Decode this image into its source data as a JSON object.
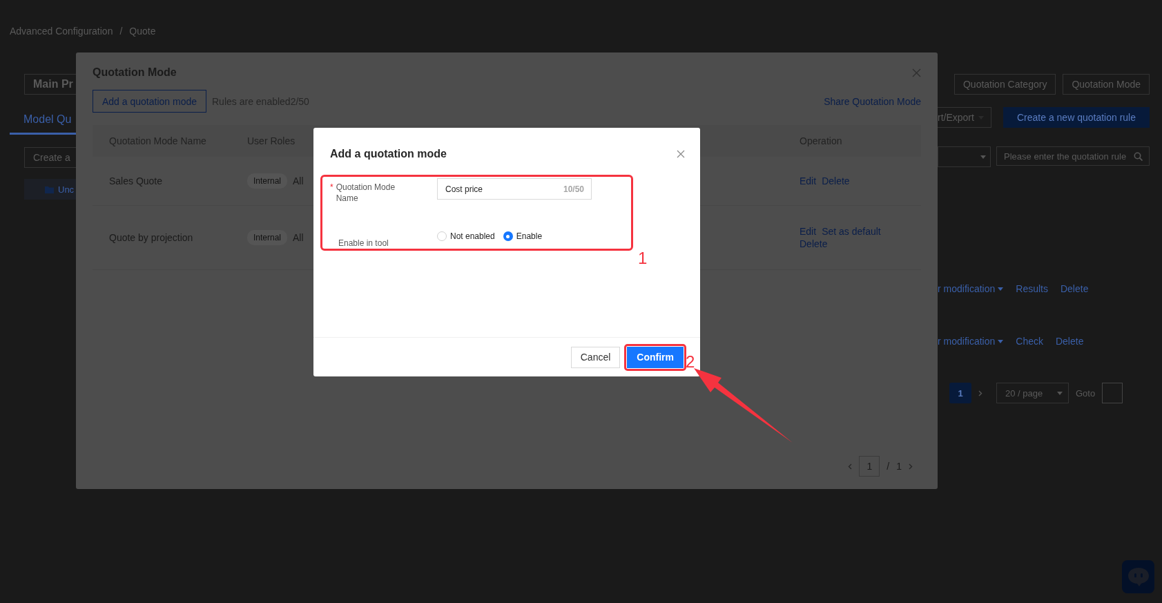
{
  "page": {
    "breadcrumb": [
      "Advanced Configuration",
      "Quote"
    ],
    "breadcrumb_separator": "/",
    "main_tab": "Main Pr",
    "subtabs": [
      {
        "label": "Model Qu",
        "selected": true
      }
    ],
    "create_button": "Create a",
    "tree_item": "Unc",
    "view_tabs": [
      "Quotation Category",
      "Quotation Mode"
    ],
    "import_export": "rt/Export",
    "create_rule_button": "Create a new quotation rule",
    "search": {
      "placeholder": "Please enter the quotation rule"
    },
    "rows": [
      {
        "actions": [
          "r modification",
          "Results",
          "Delete"
        ]
      },
      {
        "actions": [
          "r modification",
          "Check",
          "Delete"
        ]
      }
    ],
    "pagination": {
      "pages": [
        {
          "label": "1",
          "selected": true
        }
      ],
      "page_size": "20 / page",
      "goto": "Goto"
    }
  },
  "quotation_mode_modal": {
    "title": "Quotation Mode",
    "add_button": "Add a quotation mode",
    "rules_text": "Rules are enabled2/50",
    "share_link": "Share Quotation Mode",
    "columns": [
      "Quotation Mode Name",
      "User Roles",
      "Operation"
    ],
    "rows": [
      {
        "name": "Sales Quote",
        "tag": "Internal",
        "roles": "All",
        "actions": [
          "Edit",
          "Delete"
        ]
      },
      {
        "name": "Quote by projection",
        "tag": "Internal",
        "roles": "All",
        "actions": [
          "Edit",
          "Set as default",
          "Delete"
        ]
      }
    ],
    "pagination": {
      "current": "1",
      "separator": "/",
      "total": "1"
    }
  },
  "add_dialog": {
    "title": "Add a quotation mode",
    "name_field": {
      "label": "Quotation Mode Name",
      "required_mark": "*",
      "value": "Cost price",
      "counter": "10/50"
    },
    "enable_label": "Enable in tool",
    "options": [
      {
        "label": "Not enabled",
        "selected": false
      },
      {
        "label": "Enable",
        "selected": true
      }
    ],
    "buttons": [
      {
        "label": "Cancel",
        "kind": "default"
      },
      {
        "label": "Confirm",
        "kind": "primary"
      }
    ]
  },
  "annotations": [
    {
      "label": "1"
    },
    {
      "label": "2"
    }
  ]
}
